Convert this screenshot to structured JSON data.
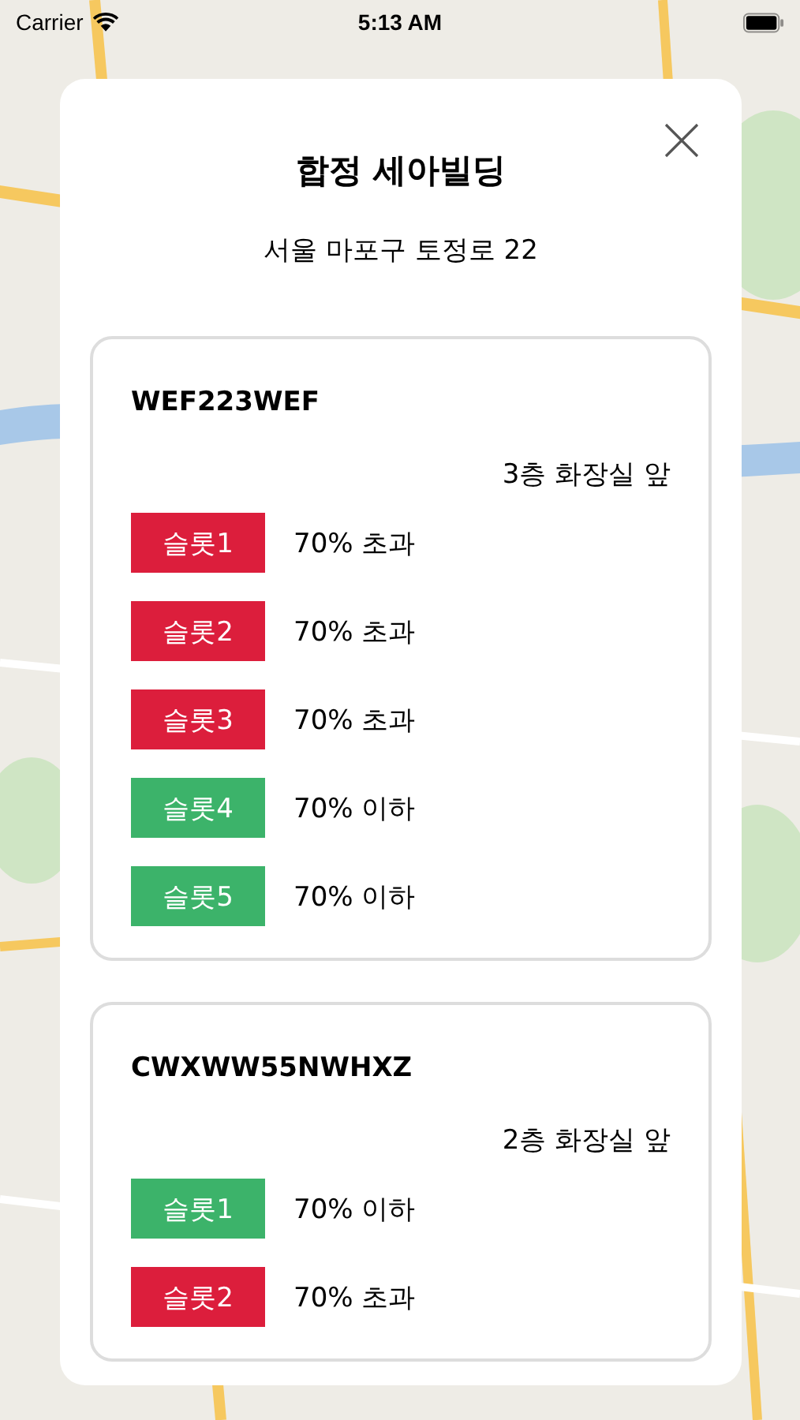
{
  "status_bar": {
    "carrier": "Carrier",
    "time": "5:13 AM"
  },
  "modal": {
    "title": "합정 세아빌딩",
    "address": "서울 마포구 토정로 22",
    "devices": [
      {
        "name": "WEF223WEF",
        "location": "3층 화장실 앞",
        "slots": [
          {
            "label": "슬롯1",
            "status": "70% 초과",
            "color": "#dc1e3c"
          },
          {
            "label": "슬롯2",
            "status": "70% 초과",
            "color": "#dc1e3c"
          },
          {
            "label": "슬롯3",
            "status": "70% 초과",
            "color": "#dc1e3c"
          },
          {
            "label": "슬롯4",
            "status": "70% 이하",
            "color": "#3cb36a"
          },
          {
            "label": "슬롯5",
            "status": "70% 이하",
            "color": "#3cb36a"
          }
        ]
      },
      {
        "name": "CWXWW55NWHXZ",
        "location": "2층 화장실 앞",
        "slots": [
          {
            "label": "슬롯1",
            "status": "70% 이하",
            "color": "#3cb36a"
          },
          {
            "label": "슬롯2",
            "status": "70% 초과",
            "color": "#dc1e3c"
          }
        ]
      }
    ]
  }
}
